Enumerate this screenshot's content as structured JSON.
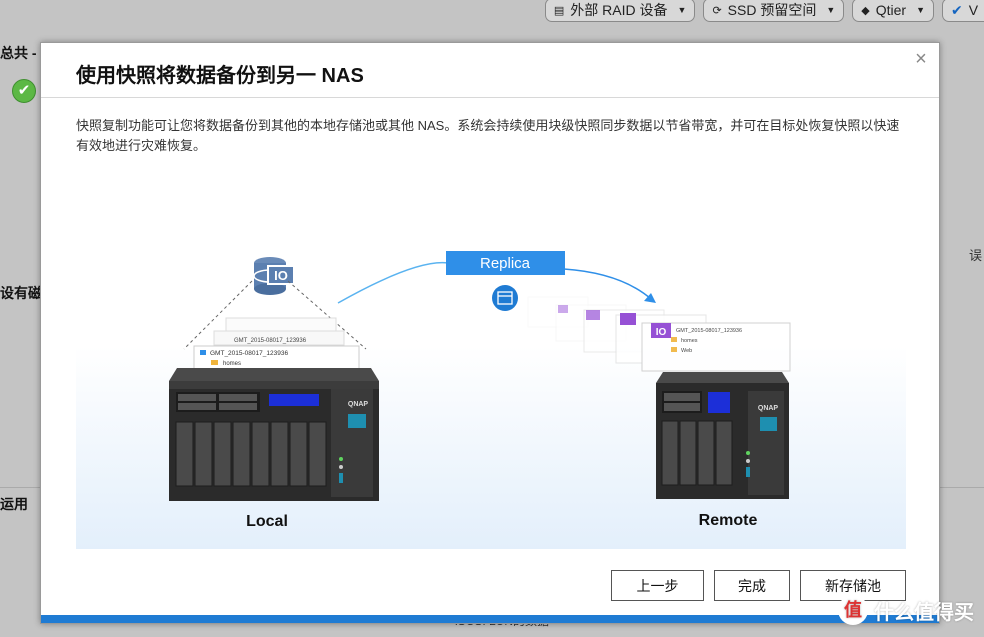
{
  "background": {
    "toolbar": {
      "buttons": [
        {
          "label": "外部 RAID 设备",
          "icon": "raid-icon"
        },
        {
          "label": "SSD 预留空间",
          "icon": "ssd-icon"
        },
        {
          "label": "Qtier",
          "icon": "qtier-icon"
        },
        {
          "label": "V",
          "icon": "v-icon"
        }
      ]
    },
    "left_labels": [
      "总共 -",
      "设有磁",
      "运用"
    ],
    "side_text": "误",
    "bottom_text": "iSCSI LUN的数据"
  },
  "dialog": {
    "title": "使用快照将数据备份到另一 NAS",
    "description": "快照复制功能可让您将数据备份到其他的本地存储池或其他 NAS。系统会持续使用块级快照同步数据以节省带宽，并可在目标处恢复快照以快速有效地进行灾难恢复。",
    "illustration": {
      "replica_label": "Replica",
      "local_label": "Local",
      "remote_label": "Remote",
      "nas_brand": "QNAP",
      "io_badge": "IO",
      "snapshot_name": "GMT_2015-08017_123936",
      "folders": [
        "homes",
        "Web"
      ],
      "accent_color": "#2f8fe8",
      "io_color": "#8b3fd1"
    },
    "buttons": {
      "back": "上一步",
      "finish": "完成",
      "new_pool": "新存储池"
    }
  },
  "watermark": {
    "logo": "值",
    "text": "什么值得买"
  }
}
